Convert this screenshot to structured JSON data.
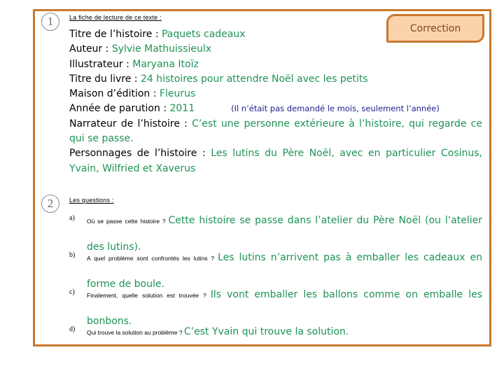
{
  "colors": {
    "frame": "#c8792f",
    "correction_bg": "#fbd3ab",
    "answer_green": "#1e9356",
    "note_blue": "#1d1f8f"
  },
  "correction_tab": {
    "label": "Correction"
  },
  "section1": {
    "number": "1",
    "heading": "La fiche de lecture de ce texte :",
    "fields": [
      {
        "label": "Titre de l’histoire : ",
        "value": "Paquets cadeaux"
      },
      {
        "label": "Auteur : ",
        "value": "Sylvie Mathuissieulx"
      },
      {
        "label": "Illustrateur : ",
        "value": "Maryana Itoïz"
      },
      {
        "label": "Titre du livre : ",
        "value": "24 histoires pour attendre Noël avec les petits"
      },
      {
        "label": "Maison d’édition : ",
        "value": "Fleurus"
      },
      {
        "label": "Année de parution : ",
        "value": "2011",
        "note": "(Il n’était pas demandé le mois, seulement l’année)"
      },
      {
        "label": "Narrateur de l’histoire : ",
        "value": "C’est une personne extérieure à l’histoire, qui regarde ce qui se passe."
      },
      {
        "label": "Personnages de l’histoire : ",
        "value": "Les lutins du Père Noël, avec en particulier Cosinus, Yvain, Wilfried et Xaverus"
      }
    ]
  },
  "section2": {
    "number": "2",
    "heading": "Les questions :",
    "questions": [
      {
        "label": "a)",
        "question": "Où se passe cette histoire ? ",
        "answer": "Cette histoire se passe dans l’atelier du Père Noël (ou l’atelier des lutins)."
      },
      {
        "label": "b)",
        "question": "A quel problème sont confrontés les lutins ? ",
        "answer": "Les lutins n’arrivent pas à emballer les cadeaux en forme de boule."
      },
      {
        "label": "c)",
        "question": "Finalement, quelle solution est trouvée ? ",
        "answer": "Ils vont emballer les ballons comme on emballe les bonbons."
      },
      {
        "label": "d)",
        "question": "Qui trouve la solution au problème ? ",
        "answer": "C’est Yvain qui trouve la solution."
      }
    ]
  }
}
